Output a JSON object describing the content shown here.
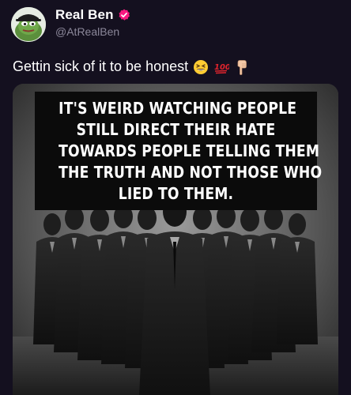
{
  "author": {
    "display_name": "Real Ben",
    "handle": "@AtRealBen",
    "verified_color": "#f91880"
  },
  "post": {
    "text": "Gettin sick of it to be honest",
    "emojis": [
      "grinning-squinting-emoji",
      "hundred-points-emoji",
      "backhand-index-pointing-down-emoji"
    ]
  },
  "media": {
    "caption_lines": [
      "IT'S WEIRD WATCHING PEOPLE",
      "STILL DIRECT THEIR HATE",
      "TOWARDS PEOPLE TELLING THEM",
      "THE TRUTH AND NOT THOSE WHO",
      "LIED TO THEM."
    ]
  }
}
